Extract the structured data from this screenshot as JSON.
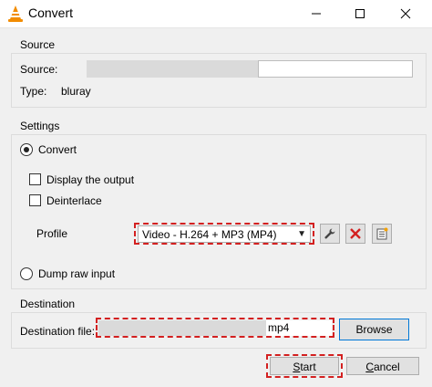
{
  "window": {
    "title": "Convert",
    "icon": "vlc-cone-icon",
    "controls": [
      "minimize-icon",
      "maximize-icon",
      "close-icon"
    ]
  },
  "source": {
    "group_label": "Source",
    "source_label": "Source:",
    "type_label": "Type:",
    "type_value": "bluray"
  },
  "settings": {
    "group_label": "Settings",
    "convert_label": "Convert",
    "convert_selected": true,
    "display_output_label": "Display the output",
    "display_output_checked": false,
    "deinterlace_label": "Deinterlace",
    "deinterlace_checked": false,
    "profile_label": "Profile",
    "profile_value": "Video - H.264 + MP3 (MP4)",
    "edit_profile_icon": "wrench-icon",
    "delete_profile_icon": "red-x-icon",
    "new_profile_icon": "new-profile-icon",
    "dump_raw_label": "Dump raw input",
    "dump_raw_selected": false
  },
  "destination": {
    "group_label": "Destination",
    "file_label": "Destination file:",
    "file_value_suffix": "mp4",
    "browse_label": "Browse"
  },
  "footer": {
    "start_label": "Start",
    "cancel_label": "Cancel"
  },
  "colors": {
    "highlight_dashed": "#d32020",
    "accent_red": "#d32020"
  }
}
